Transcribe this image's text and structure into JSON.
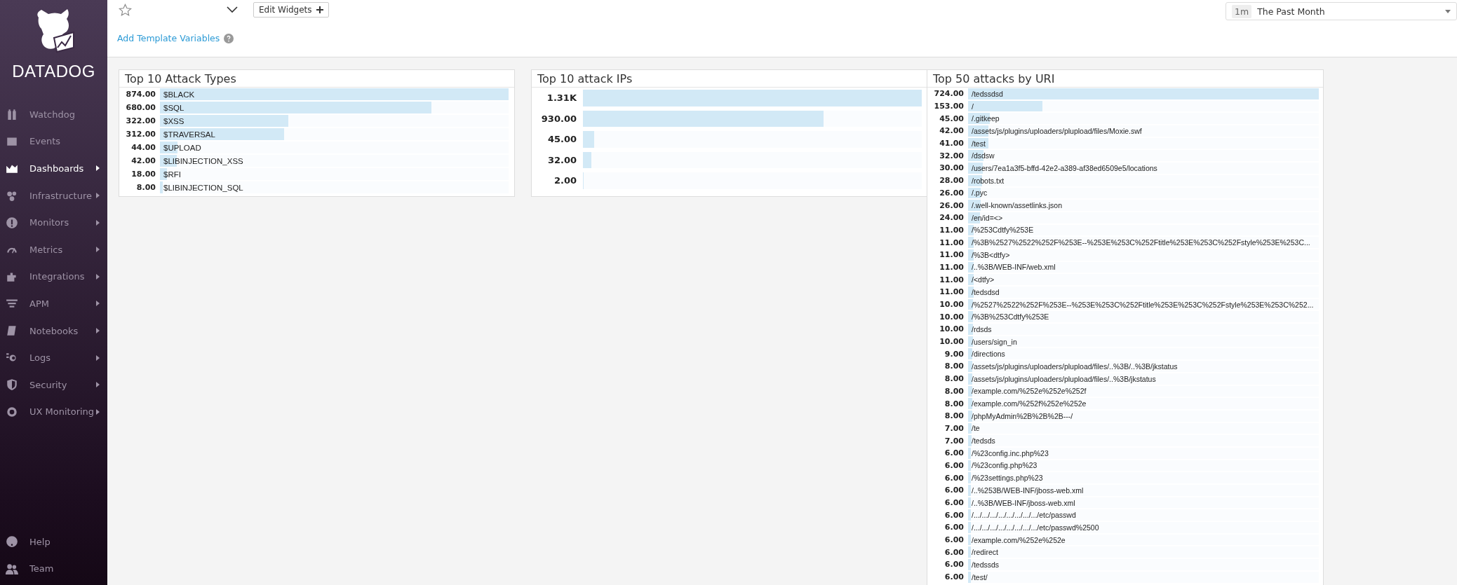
{
  "sidebar": {
    "logo_text": "DATADOG",
    "items": [
      {
        "label": "Watchdog",
        "selected": false,
        "expandable": false
      },
      {
        "label": "Events",
        "selected": false,
        "expandable": false
      },
      {
        "label": "Dashboards",
        "selected": true,
        "expandable": true
      },
      {
        "label": "Infrastructure",
        "selected": false,
        "expandable": true
      },
      {
        "label": "Monitors",
        "selected": false,
        "expandable": true
      },
      {
        "label": "Metrics",
        "selected": false,
        "expandable": true
      },
      {
        "label": "Integrations",
        "selected": false,
        "expandable": true
      },
      {
        "label": "APM",
        "selected": false,
        "expandable": true
      },
      {
        "label": "Notebooks",
        "selected": false,
        "expandable": true
      },
      {
        "label": "Logs",
        "selected": false,
        "expandable": true
      },
      {
        "label": "Security",
        "selected": false,
        "expandable": true
      },
      {
        "label": "UX Monitoring",
        "selected": false,
        "expandable": true
      }
    ],
    "bottom_items": [
      {
        "label": "Help"
      },
      {
        "label": "Team"
      }
    ]
  },
  "toolbar": {
    "edit_button": "Edit Widgets",
    "template_link": "Add Template Variables",
    "time_badge": "1m",
    "time_range": "The Past Month"
  },
  "widgets": [
    {
      "title": "Top 10 Attack Types",
      "rows": [
        {
          "value": "874.00",
          "label": "$BLACK",
          "level": 1
        },
        {
          "value": "680.00",
          "label": "$SQL",
          "level": 0.778
        },
        {
          "value": "322.00",
          "label": "$XSS",
          "level": 0.368
        },
        {
          "value": "312.00",
          "label": "$TRAVERSAL",
          "level": 0.357
        },
        {
          "value": "44.00",
          "label": "$UPLOAD",
          "level": 0.05
        },
        {
          "value": "42.00",
          "label": "$LIBINJECTION_XSS",
          "level": 0.048
        },
        {
          "value": "18.00",
          "label": "$RFI",
          "level": 0.021
        },
        {
          "value": "8.00",
          "label": "$LIBINJECTION_SQL",
          "level": 0.009
        }
      ]
    },
    {
      "title": "Top 10 attack IPs",
      "rows": [
        {
          "value": "1.31K",
          "level": 1
        },
        {
          "value": "930.00",
          "level": 0.71
        },
        {
          "value": "45.00",
          "level": 0.034
        },
        {
          "value": "32.00",
          "level": 0.024
        },
        {
          "value": "2.00",
          "level": 0.002
        }
      ]
    },
    {
      "title": "Top 50 attacks by URI",
      "rows": [
        {
          "value": "724.00",
          "label": "/tedssdsd",
          "level": 1
        },
        {
          "value": "153.00",
          "label": "/",
          "level": 0.211
        },
        {
          "value": "45.00",
          "label": "/.gitkeep",
          "level": 0.062
        },
        {
          "value": "42.00",
          "label": "/assets/js/plugins/uploaders/plupload/files/Moxie.swf",
          "level": 0.058
        },
        {
          "value": "41.00",
          "label": "/test",
          "level": 0.057
        },
        {
          "value": "32.00",
          "label": "/dsdsw",
          "level": 0.044
        },
        {
          "value": "30.00",
          "label": "/users/7ea1a3f5-bffd-42e2-a389-af38ed6509e5/locations",
          "level": 0.041
        },
        {
          "value": "28.00",
          "label": "/robots.txt",
          "level": 0.039
        },
        {
          "value": "26.00",
          "label": "/.pyc",
          "level": 0.036
        },
        {
          "value": "26.00",
          "label": "/.well-known/assetlinks.json",
          "level": 0.036
        },
        {
          "value": "24.00",
          "label": "/en/id=<>",
          "level": 0.033
        },
        {
          "value": "11.00",
          "label": "/%253Cdtfy%253E",
          "level": 0.015
        },
        {
          "value": "11.00",
          "label": "/%3B%2527%2522%252F%253E--%253E%253C%252Ftitle%253E%253C%252Fstyle%253E%253C...",
          "level": 0.015
        },
        {
          "value": "11.00",
          "label": "/%3B<dtfy>",
          "level": 0.015
        },
        {
          "value": "11.00",
          "label": "/..%3B/WEB-INF/web.xml",
          "level": 0.015
        },
        {
          "value": "11.00",
          "label": "/<dtfy>",
          "level": 0.015
        },
        {
          "value": "11.00",
          "label": "/tedsdsd",
          "level": 0.015
        },
        {
          "value": "10.00",
          "label": "/%2527%2522%252F%253E--%253E%253C%252Ftitle%253E%253C%252Fstyle%253E%253C%252...",
          "level": 0.014
        },
        {
          "value": "10.00",
          "label": "/%3B%253Cdtfy%253E",
          "level": 0.014
        },
        {
          "value": "10.00",
          "label": "/rdsds",
          "level": 0.014
        },
        {
          "value": "10.00",
          "label": "/users/sign_in",
          "level": 0.014
        },
        {
          "value": "9.00",
          "label": "/directions",
          "level": 0.012
        },
        {
          "value": "8.00",
          "label": "/assets/js/plugins/uploaders/plupload/files/..%3B/..%3B/jkstatus",
          "level": 0.011
        },
        {
          "value": "8.00",
          "label": "/assets/js/plugins/uploaders/plupload/files/..%3B/jkstatus",
          "level": 0.011
        },
        {
          "value": "8.00",
          "label": "/example.com/%252e%252e%252f",
          "level": 0.011
        },
        {
          "value": "8.00",
          "label": "/example.com/%252f%252e%252e",
          "level": 0.011
        },
        {
          "value": "8.00",
          "label": "/phpMyAdmin%2B%2B%2B---/",
          "level": 0.011
        },
        {
          "value": "7.00",
          "label": "/te",
          "level": 0.01
        },
        {
          "value": "7.00",
          "label": "/tedsds",
          "level": 0.01
        },
        {
          "value": "6.00",
          "label": "/%23config.inc.php%23",
          "level": 0.008
        },
        {
          "value": "6.00",
          "label": "/%23config.php%23",
          "level": 0.008
        },
        {
          "value": "6.00",
          "label": "/%23settings.php%23",
          "level": 0.008
        },
        {
          "value": "6.00",
          "label": "/..%253B/WEB-INF/jboss-web.xml",
          "level": 0.008
        },
        {
          "value": "6.00",
          "label": "/..%3B/WEB-INF/jboss-web.xml",
          "level": 0.008
        },
        {
          "value": "6.00",
          "label": "/.../.../.../.../.../.../.../.../etc/passwd",
          "level": 0.008
        },
        {
          "value": "6.00",
          "label": "/.../.../.../.../.../.../.../.../etc/passwd%2500",
          "level": 0.008
        },
        {
          "value": "6.00",
          "label": "/example.com/%252e%252e",
          "level": 0.008
        },
        {
          "value": "6.00",
          "label": "/redirect",
          "level": 0.008
        },
        {
          "value": "6.00",
          "label": "/tedssds",
          "level": 0.008
        },
        {
          "value": "6.00",
          "label": "/test/",
          "level": 0.008
        }
      ]
    }
  ]
}
